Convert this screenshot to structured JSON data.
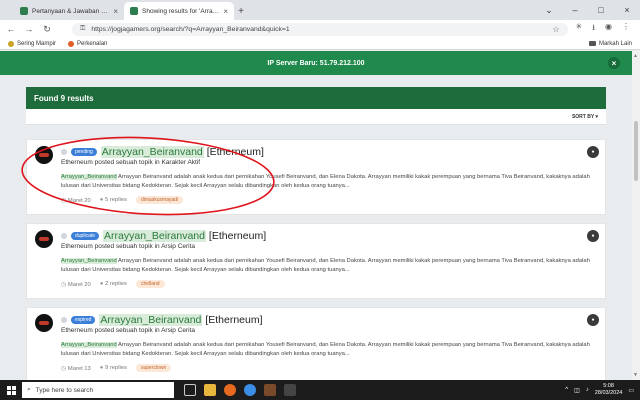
{
  "browser": {
    "tabs": [
      {
        "title": "Pertanyaan & Jawaban - Jogja...",
        "active": false
      },
      {
        "title": "Showing results for 'Arrayyan_B...",
        "active": true
      }
    ],
    "url": "https://jogjagamers.org/search/?q=Arrayyan_Beiranvand&quick=1",
    "bookmarks": [
      {
        "label": "Sering Mampir"
      },
      {
        "label": "Perkenalan"
      }
    ],
    "bookmarks_right": "Markah Lain"
  },
  "banner": {
    "text": "IP Server Baru: 51.79.212.100"
  },
  "results": {
    "heading": "Found 9 results",
    "sort_label": "SORT BY ▾",
    "items": [
      {
        "status": "pending",
        "status_color": "#3b7fd9",
        "title_highlight": "Arrayyan_Beiranvand",
        "title_rest": "[Etherneum]",
        "posted": "Etherneum posted sebuah topik in Karakter Aktif",
        "snippet_highlight": "Arrayyan_Beiranvand",
        "snippet": " Arrayyan Beiranvand adalah anak kedua dari pernikahan Yousefi Beiranvand, dan Elena Dakota. Arrayyan memiliki kakak perempuan yang bernama Tiva Beiranvand, kakaknya adalah lulusan dari Universitas bidang Kedokteran. Sejak kecil Arrayyan selalu dibandingkan oleh kedua orang tuanya...",
        "date": "Maret 20",
        "replies": "5 replies",
        "tag": "dimaskusmayadi"
      },
      {
        "status": "duplicate",
        "status_color": "#3b7fd9",
        "title_highlight": "Arrayyan_Beiranvand",
        "title_rest": "[Etherneum]",
        "posted": "Etherneum posted sebuah topik in Arsip Cerita",
        "snippet_highlight": "Arrayyan_Beiranvand",
        "snippet": " Arrayyan Beiranvand adalah anak kedua dari pernikahan Yousefi Beiranvand, dan Elena Dakota. Arrayyan memiliki kakak perempuan yang bernama Tiva Beiranvand, kakaknya adalah lulusan dari Universitas bidang Kedokteran. Sejak kecil Arrayyan selalu dibandingkan oleh kedua orang tuanya...",
        "date": "Maret 20",
        "replies": "2 replies",
        "tag": "chelland"
      },
      {
        "status": "expired",
        "status_color": "#3b7fd9",
        "title_highlight": "Arrayyan_Beiranvand",
        "title_rest": "[Etherneum]",
        "posted": "Etherneum posted sebuah topik in Arsip Cerita",
        "snippet_highlight": "Arrayyan_Beiranvand",
        "snippet": " Arrayyan Beiranvand adalah anak kedua dari pernikahan Yousefi Beiranvand, dan Elena Dakota. Arrayyan memiliki kakak perempuan yang bernama Tiva Beiranvand, kakaknya adalah lulusan dari Universitas bidang Kedokteran. Sejak kecil Arrayyan selalu dibandingkan oleh kedua orang tuanya...",
        "date": "Maret 13",
        "replies": "9 replies",
        "tag": "superclown"
      }
    ]
  },
  "taskbar": {
    "search_placeholder": "Type here to search",
    "time": "5:08",
    "date": "28/03/2024"
  },
  "colors": {
    "banner": "#1f8a4c",
    "results_header": "#1e6b3c",
    "annotation": "#e0141c"
  }
}
